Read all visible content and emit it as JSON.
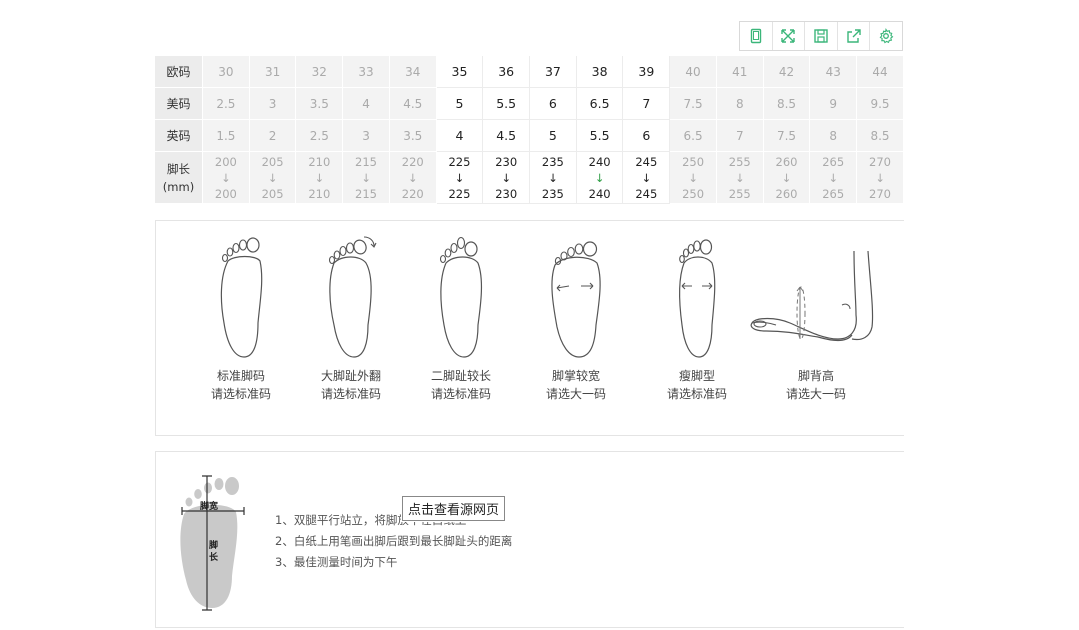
{
  "toolbar": {
    "buttons": [
      {
        "icon": "phone-icon"
      },
      {
        "icon": "fullscreen-icon"
      },
      {
        "icon": "save-icon"
      },
      {
        "icon": "share-icon"
      },
      {
        "icon": "settings-gear-icon"
      }
    ],
    "accent_color": "#3bb67a"
  },
  "size_table": {
    "row_labels": {
      "eu": "欧码",
      "us": "美码",
      "uk": "英码",
      "foot_length": "脚长",
      "unit": "(mm)"
    },
    "eu": [
      "30",
      "31",
      "32",
      "33",
      "34",
      "35",
      "36",
      "37",
      "38",
      "39",
      "40",
      "41",
      "42",
      "43",
      "44"
    ],
    "us": [
      "2.5",
      "3",
      "3.5",
      "4",
      "4.5",
      "5",
      "5.5",
      "6",
      "6.5",
      "7",
      "7.5",
      "8",
      "8.5",
      "9",
      "9.5"
    ],
    "uk": [
      "1.5",
      "2",
      "2.5",
      "3",
      "3.5",
      "4",
      "4.5",
      "5",
      "5.5",
      "6",
      "6.5",
      "7",
      "7.5",
      "8",
      "8.5"
    ],
    "foot_length": [
      "200",
      "205",
      "210",
      "215",
      "220",
      "225",
      "230",
      "235",
      "240",
      "245",
      "250",
      "255",
      "260",
      "265",
      "270"
    ],
    "arrow": "↓",
    "highlight_range": [
      "35",
      "39"
    ]
  },
  "foot_types": [
    {
      "name": "标准脚码",
      "advice": "请选标准码"
    },
    {
      "name": "大脚趾外翻",
      "advice": "请选标准码"
    },
    {
      "name": "二脚趾较长",
      "advice": "请选标准码"
    },
    {
      "name": "脚掌较宽",
      "advice": "请选大一码"
    },
    {
      "name": "瘦脚型",
      "advice": "请选标准码"
    },
    {
      "name": "脚背高",
      "advice": "请选大一码"
    }
  ],
  "measure": {
    "diagram_labels": {
      "width": "脚宽",
      "length_1": "脚",
      "length_2": "长"
    },
    "steps": [
      "1、双腿平行站立，将脚放平在白纸上",
      "2、白纸上用笔画出脚后跟到最长脚趾头的距离",
      "3、最佳测量时间为下午"
    ]
  },
  "overlay_link": "点击查看源网页"
}
